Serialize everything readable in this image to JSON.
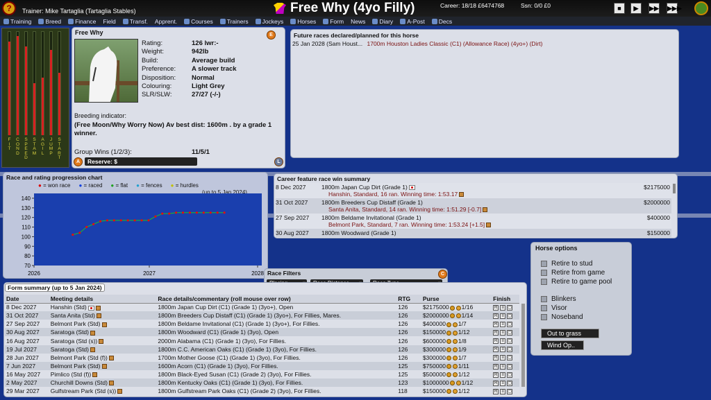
{
  "topbar": {
    "trainer": "Trainer:  Mike Tartaglia (Tartaglia Stables)",
    "title": "Free Why (4yo Filly)",
    "career": "Career: 18/18 £6474768",
    "season": "Ssn: 0/0 £0"
  },
  "nav": [
    "Training",
    "Breed",
    "Finance",
    "Field",
    "Transf.",
    "Apprent.",
    "Courses",
    "Trainers",
    "Jockeys",
    "Horses",
    "Form",
    "News",
    "Diary",
    "A-Post",
    "Decs"
  ],
  "bars": {
    "labels": [
      "FITNESS",
      "CONDITION",
      "SPEED",
      "STAMINA",
      "AGILITY",
      "JUMPING",
      "START"
    ],
    "labels_short": [
      "F\nI\nT",
      "C\nO\nN\nD",
      "S\nP\nE\nE\nD",
      "S\nT\nA\nM",
      "A\nG\nI\nL",
      "J\nU\nM\nP",
      "S\nT\nA\nR\nT"
    ],
    "levels": [
      0.9,
      0.95,
      0.85,
      0.5,
      0.55,
      0.82,
      0.6
    ]
  },
  "horse": {
    "name": "Free Why",
    "rows": [
      [
        "Rating:",
        "126 lwr:-"
      ],
      [
        "Weight:",
        "942lb"
      ],
      [
        "Build:",
        "Average build"
      ],
      [
        "Preference:",
        "A slower track"
      ],
      [
        "Disposition:",
        "Normal"
      ],
      [
        "Colouring:",
        "Light Grey"
      ],
      [
        "SLR/SLW:",
        "27/27  (-/-)"
      ]
    ],
    "breeding_label": "Breeding indicator:",
    "breeding_text": "(Free Moon/Why Worry Now) Av best dist: 1600m . by a grade 1 winner.",
    "group_label": "Group Wins (1/2/3):",
    "group_value": "11/5/1",
    "reserve": "Reserve: $"
  },
  "future": {
    "title": "Future races declared/planned for this horse",
    "row_date": "25 Jan 2028 (Sam Houst...",
    "row_race": "1700m Houston Ladies Classic (C1) (Allowance Race) (4yo+) (Dirt)"
  },
  "chart": {
    "title": "Race and rating progression chart",
    "legend": [
      "= won race",
      "= raced",
      "= flat",
      "= fences",
      "= hurdles"
    ],
    "note": "(up to 5 Jan 2024)"
  },
  "chart_data": {
    "type": "line",
    "x_ticks": [
      "2026",
      "2027",
      "2028"
    ],
    "y_ticks": [
      140,
      130,
      120,
      110,
      100,
      90,
      80,
      70
    ],
    "ylim": [
      70,
      145
    ],
    "points": [
      [
        0.08,
        102
      ],
      [
        0.12,
        104
      ],
      [
        0.16,
        110
      ],
      [
        0.2,
        113
      ],
      [
        0.24,
        116
      ],
      [
        0.28,
        117
      ],
      [
        0.32,
        117
      ],
      [
        0.36,
        117
      ],
      [
        0.4,
        117
      ],
      [
        0.44,
        117
      ],
      [
        0.48,
        117
      ],
      [
        0.52,
        117
      ],
      [
        0.56,
        121
      ],
      [
        0.6,
        124
      ],
      [
        0.64,
        124
      ],
      [
        0.68,
        125
      ],
      [
        0.72,
        125
      ],
      [
        0.76,
        125
      ],
      [
        0.8,
        125
      ],
      [
        0.84,
        125
      ],
      [
        0.88,
        125
      ],
      [
        0.92,
        125
      ],
      [
        0.96,
        125
      ]
    ]
  },
  "feature": {
    "title": "Career feature race win summary",
    "rows": [
      {
        "date": "8 Dec 2027",
        "race": "1800m  Japan Cup Dirt (Grade 1)",
        "detail": "Hanshin, Standard, 16 ran.  Winning time: 1:53.17",
        "prize": "$2175000"
      },
      {
        "date": "31 Oct 2027",
        "race": "1800m  Breeders Cup Distaff (Grade 1)",
        "detail": "Santa Anita, Standard, 14 ran.  Winning time: 1:51.29 [-0.7]",
        "prize": "$2000000"
      },
      {
        "date": "27 Sep 2027",
        "race": "1800m  Beldame Invitational (Grade 1)",
        "detail": "Belmont Park, Standard, 7 ran.  Winning time: 1:53.24 [+1.5]",
        "prize": "$400000"
      },
      {
        "date": "30 Aug 2027",
        "race": "1800m  Woodward (Grade 1)",
        "detail": "",
        "prize": "$150000"
      }
    ]
  },
  "options": {
    "title": "Horse options",
    "items": [
      "Retire to stud",
      "Retire from game",
      "Retire to game pool",
      "Blinkers",
      "Visor",
      "Noseband"
    ],
    "out": "Out to grass",
    "wind": "Wind Op.."
  },
  "filters": {
    "title": "Race Filters",
    "placing": "Placing",
    "distance": "Race Distance",
    "type": "Race Type"
  },
  "form": {
    "title": "Form summary (up to 5 Jan 2024)",
    "headers": [
      "Date",
      "Meeting details",
      "Race details/commentary (roll mouse over row)",
      "RTG",
      "Purse",
      "Finish"
    ],
    "rows": [
      [
        "8 Dec 2027",
        "Hanshin (Std)",
        "1800m Japan Cup Dirt (C1) (Grade 1) (3yo+), Open",
        "126",
        "$2175000",
        "1/16"
      ],
      [
        "31 Oct 2027",
        "Santa Anita (Std)",
        "1800m Breeders Cup Distaff (C1) (Grade 1) (3yo+), For Fillies, Mares.",
        "126",
        "$2000000",
        "1/14"
      ],
      [
        "27 Sep 2027",
        "Belmont Park (Std)",
        "1800m Beldame Invitational (C1) (Grade 1) (3yo+), For Fillies.",
        "126",
        "$400000",
        "1/7"
      ],
      [
        "30 Aug 2027",
        "Saratoga (Std)",
        "1800m Woodward (C1) (Grade 1) (3yo), Open",
        "126",
        "$150000",
        "1/12"
      ],
      [
        "16 Aug 2027",
        "Saratoga (Std (s))",
        "2000m Alabama (C1) (Grade 1) (3yo), For Fillies.",
        "126",
        "$600000",
        "1/8"
      ],
      [
        "19 Jul 2027",
        "Saratoga (Std)",
        "1800m C.C. American Oaks (C1) (Grade 1) (3yo), For Fillies.",
        "126",
        "$300000",
        "1/9"
      ],
      [
        "28 Jun 2027",
        "Belmont Park (Std (f))",
        "1700m Mother Goose (C1) (Grade 1) (3yo), For Fillies.",
        "126",
        "$300000",
        "1/7"
      ],
      [
        "7 Jun 2027",
        "Belmont Park (Std)",
        "1600m Acorn (C1) (Grade 1) (3yo), For Fillies.",
        "125",
        "$750000",
        "1/11"
      ],
      [
        "16 May 2027",
        "Pimlico (Std (f))",
        "1800m Black-Eyed Susan (C1) (Grade 2) (3yo), For Fillies.",
        "125",
        "$500000",
        "1/12"
      ],
      [
        "2 May 2027",
        "Churchill Downs (Std)",
        "1800m Kentucky Oaks (C1) (Grade 1) (3yo), For Fillies.",
        "123",
        "$1000000",
        "1/12"
      ],
      [
        "29 Mar 2027",
        "Gulfstream Park (Std (s))",
        "1800m Gulfstream Park Oaks (C1) (Grade 2) (3yo), For Fillies.",
        "118",
        "$150000",
        "1/12"
      ]
    ]
  }
}
